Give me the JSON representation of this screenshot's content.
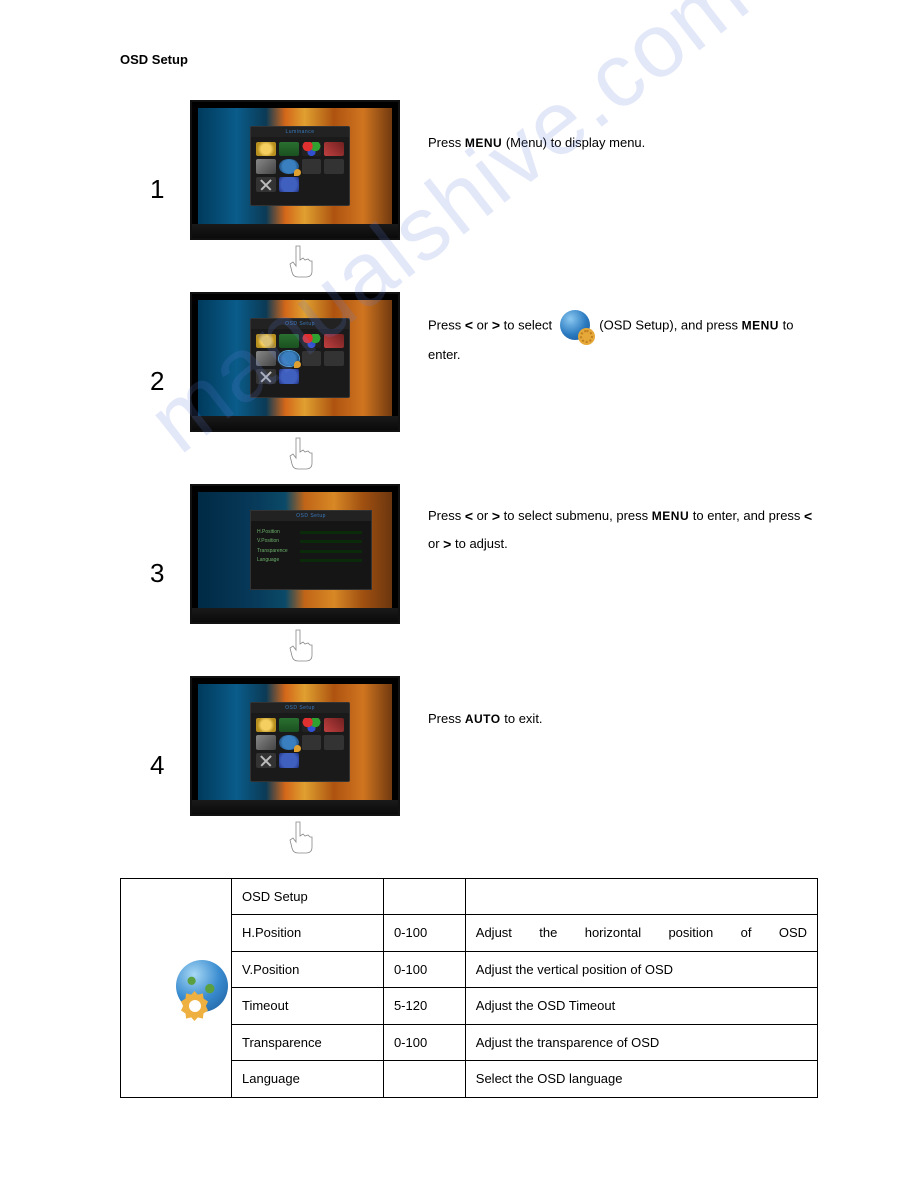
{
  "title": "OSD Setup",
  "watermark": "manualshive.com",
  "buttons": {
    "menu": "MENU",
    "auto": "AUTO",
    "left": "<",
    "right": ">"
  },
  "steps": [
    {
      "num": "1",
      "osd_title": "Luminance",
      "text": {
        "press": "Press ",
        "after_menu": " (Menu) to display menu."
      }
    },
    {
      "num": "2",
      "osd_title": "OSD Setup",
      "text": {
        "press": "Press ",
        "or1": " or ",
        "to_select": " to select ",
        "osd_setup": " (OSD Setup), and press ",
        "to_enter": " to enter."
      }
    },
    {
      "num": "3",
      "osd_title": "OSD Setup",
      "submenu": [
        {
          "label": "H.Position",
          "fill": 50
        },
        {
          "label": "V.Position",
          "fill": 50
        },
        {
          "label": "Transparence",
          "fill": 30
        },
        {
          "label": "Language",
          "fill": 0
        }
      ],
      "text": {
        "press": "Press ",
        "or1": " or ",
        "to_select_sub": " to select submenu, press ",
        "to_enter_press": " to enter, and press ",
        "or2": " or ",
        "to_adjust": " to adjust."
      }
    },
    {
      "num": "4",
      "osd_title": "OSD Setup",
      "text": {
        "press": "Press ",
        "to_exit": " to exit."
      }
    }
  ],
  "table": {
    "header": "OSD Setup",
    "rows": [
      {
        "name": "H.Position",
        "range": "0-100",
        "desc": "Adjust the horizontal position of OSD"
      },
      {
        "name": "V.Position",
        "range": "0-100",
        "desc": "Adjust the vertical position of OSD"
      },
      {
        "name": "Timeout",
        "range": "5-120",
        "desc": "Adjust the OSD Timeout"
      },
      {
        "name": "Transparence",
        "range": "0-100",
        "desc": "Adjust the transparence of OSD"
      },
      {
        "name": "Language",
        "range": "",
        "desc": "Select the OSD language"
      }
    ]
  }
}
